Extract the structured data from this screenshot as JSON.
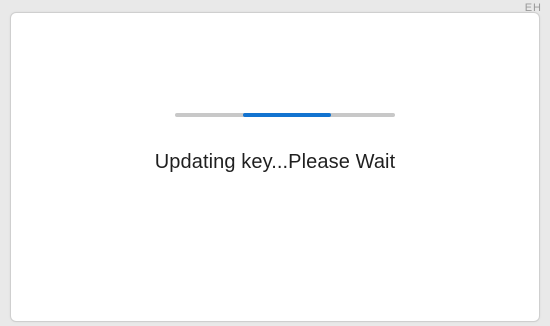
{
  "corner": {
    "label": "EH"
  },
  "dialog": {
    "status_text": "Updating key...Please Wait",
    "progress": {
      "indeterminate": true,
      "indicator_start_fraction": 0.31,
      "indicator_length_fraction": 0.4
    }
  },
  "colors": {
    "track": "#c8c8c8",
    "indicator": "#1273d0",
    "text": "#1f1f1f"
  }
}
